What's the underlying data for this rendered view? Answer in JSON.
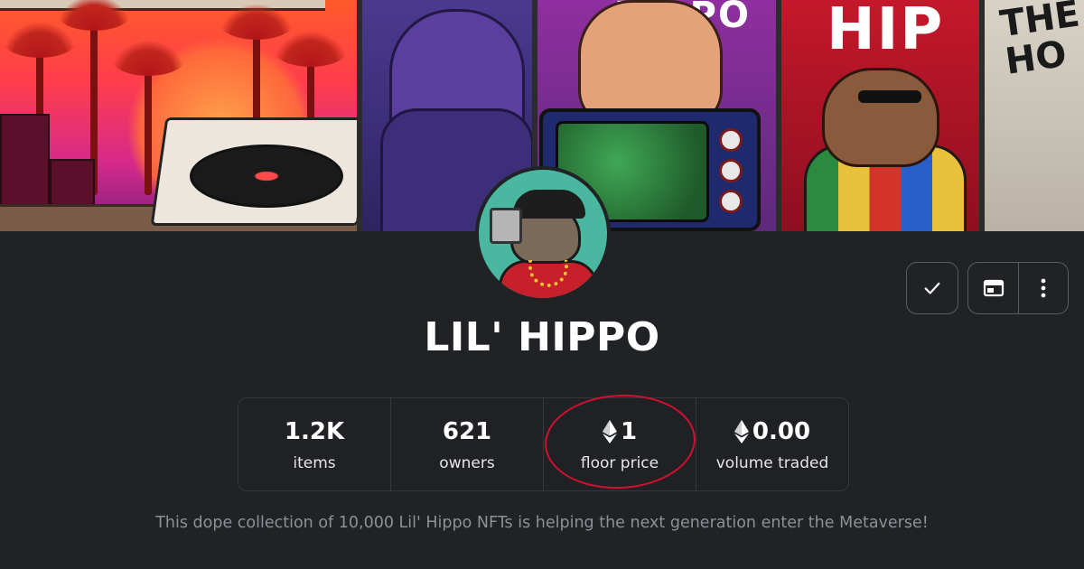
{
  "banner": {
    "tv_text": "HIPPO",
    "hip_text": "HIP",
    "graffiti_text": "THE HO"
  },
  "collection": {
    "name": "LIL' HIPPO",
    "description": "This dope collection of 10,000 Lil' Hippo NFTs is helping the next generation enter the Metaverse!"
  },
  "stats": [
    {
      "value": "1.2K",
      "label": "items",
      "eth": false
    },
    {
      "value": "621",
      "label": "owners",
      "eth": false
    },
    {
      "value": "1",
      "label": "floor price",
      "eth": true
    },
    {
      "value": "0.00",
      "label": "volume traded",
      "eth": true
    }
  ],
  "actions": {
    "icons": [
      "check-icon",
      "embed-icon",
      "more-vertical-icon"
    ]
  },
  "colors": {
    "background": "#202225",
    "highlight_ring": "#d2102f",
    "muted_text": "#8d9096"
  }
}
